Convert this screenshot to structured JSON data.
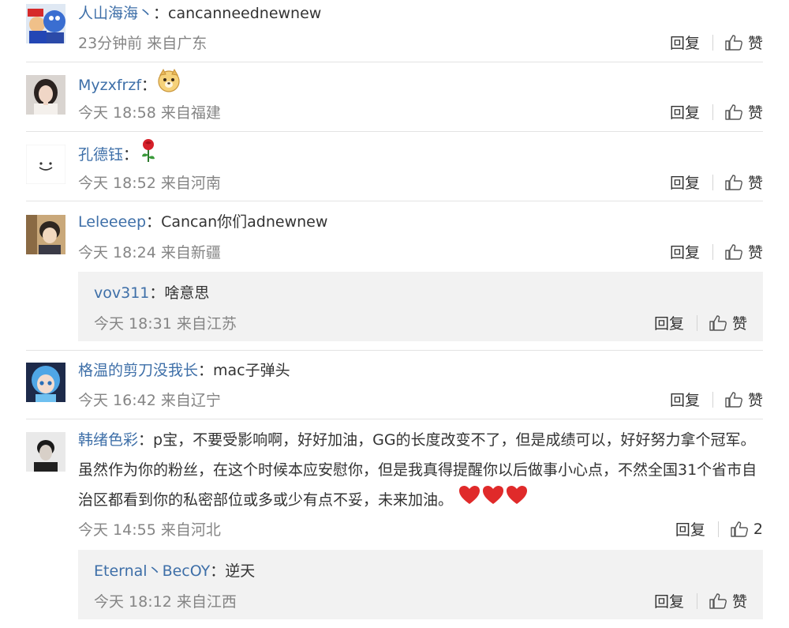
{
  "comments": [
    {
      "user": "人山海海丶",
      "text": "cancanneednewnew",
      "time": "23分钟前",
      "location": "来自广东",
      "reply": "回复",
      "like": "赞",
      "avatar": "mario-icon"
    },
    {
      "user": "Myzxfrzf",
      "text": "",
      "time": "今天 18:58",
      "location": "来自福建",
      "reply": "回复",
      "like": "赞",
      "avatar": "girl-photo",
      "emoji": "doge-emoji"
    },
    {
      "user": "孔德钰",
      "text": "",
      "time": "今天 18:52",
      "location": "来自河南",
      "reply": "回复",
      "like": "赞",
      "avatar": "smile-icon",
      "emoji": "rose-emoji"
    },
    {
      "user": "Leleeeep",
      "text": "Cancan你们adnewnew",
      "time": "今天 18:24",
      "location": "来自新疆",
      "reply": "回复",
      "like": "赞",
      "avatar": "anime-boy",
      "subreply": {
        "user": "vov311",
        "text": "啥意思",
        "time": "今天 18:31",
        "location": "来自江苏",
        "reply": "回复",
        "like": "赞"
      }
    },
    {
      "user": "格温的剪刀没我长",
      "text": "mac子弹头",
      "time": "今天 16:42",
      "location": "来自辽宁",
      "reply": "回复",
      "like": "赞",
      "avatar": "anime-girl"
    },
    {
      "user": "韩绪色彩",
      "text": "p宝，不要受影响啊，好好加油，GG的长度改变不了，但是成绩可以，好好努力拿个冠军。虽然作为你的粉丝，在这个时候本应安慰你，但是我真得提醒你以后做事小心点，不然全国31个省市自治区都看到你的私密部位或多或少有点不妥，未来加油。",
      "time": "今天 14:55",
      "location": "来自河北",
      "reply": "回复",
      "like": "2",
      "avatar": "man-photo",
      "emoji": "heart-emoji-x3",
      "subreply": {
        "user": "Eternal丶BecOY",
        "text": "逆天",
        "time": "今天 18:12",
        "location": "来自江西",
        "reply": "回复",
        "like": "赞"
      }
    }
  ],
  "colors": {
    "username": "#3e6fa8",
    "meta": "#858585",
    "subreply_bg": "#f2f2f2",
    "divider": "#e3e3e3"
  }
}
